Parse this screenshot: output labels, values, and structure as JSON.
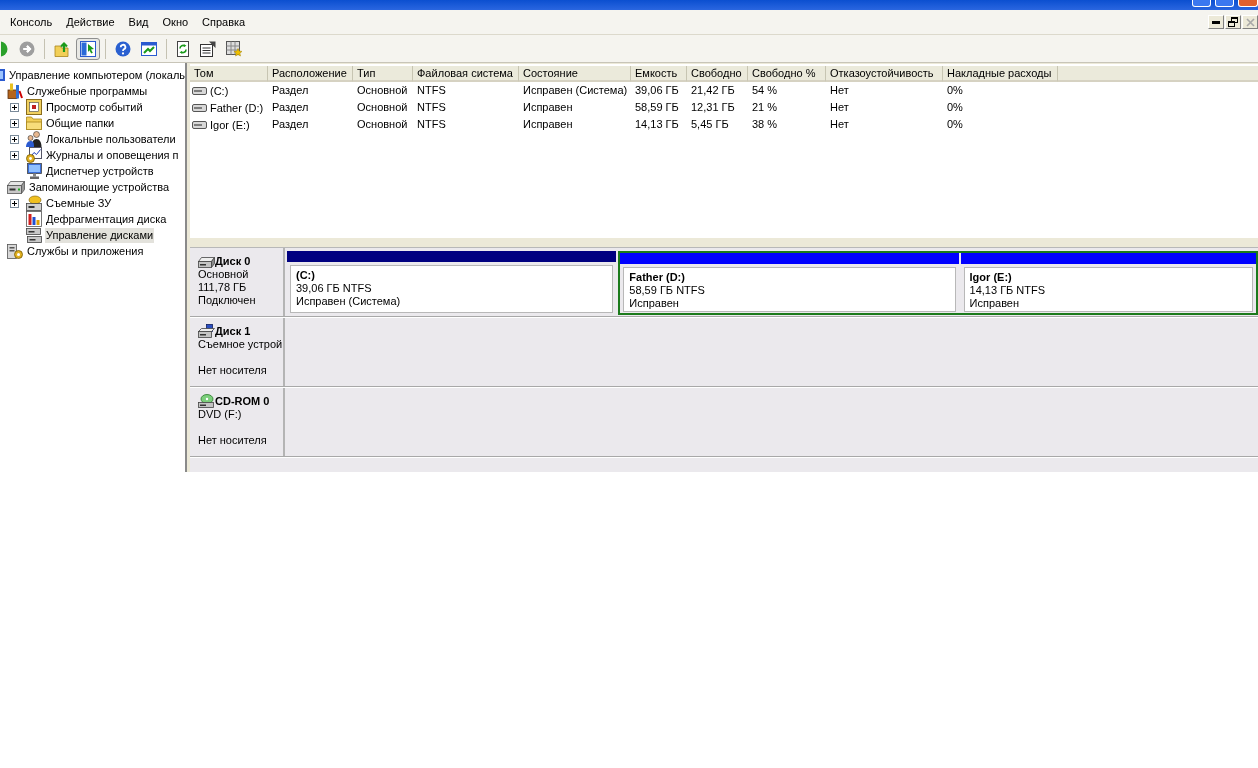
{
  "menu": [
    "Консоль",
    "Действие",
    "Вид",
    "Окно",
    "Справка"
  ],
  "window_controls": [
    {
      "disabled": false
    },
    {
      "disabled": false
    },
    {
      "disabled": true
    }
  ],
  "toolbar": [
    [
      {
        "pressed": false,
        "disabled": false
      },
      {
        "pressed": false,
        "disabled": true
      }
    ],
    [
      {
        "pressed": false,
        "disabled": false
      },
      {
        "pressed": true,
        "disabled": false
      }
    ],
    [
      {
        "pressed": false,
        "disabled": false
      },
      {
        "pressed": false,
        "disabled": false
      }
    ],
    [
      {
        "pressed": false,
        "disabled": false
      },
      {
        "pressed": false,
        "disabled": false
      },
      {
        "pressed": false,
        "disabled": false
      }
    ]
  ],
  "tree": [
    {
      "label": "Управление компьютером (локаль",
      "collapsed": false,
      "selected": false,
      "children": [
        {
          "label": "Служебные программы",
          "collapsed": false,
          "selected": false,
          "children": [
            {
              "label": "Просмотр событий",
              "collapsed": true,
              "selected": false
            },
            {
              "label": "Общие папки",
              "collapsed": true,
              "selected": false
            },
            {
              "label": "Локальные пользователи",
              "collapsed": true,
              "selected": false
            },
            {
              "label": "Журналы и оповещения п",
              "collapsed": true,
              "selected": false
            },
            {
              "label": "Диспетчер устройств",
              "collapsed": false,
              "selected": false
            }
          ]
        },
        {
          "label": "Запоминающие устройства",
          "collapsed": false,
          "selected": false,
          "children": [
            {
              "label": "Съемные ЗУ",
              "collapsed": true,
              "selected": false
            },
            {
              "label": "Дефрагментация диска",
              "collapsed": false,
              "selected": false
            },
            {
              "label": "Управление дисками",
              "collapsed": false,
              "selected": true
            }
          ]
        },
        {
          "label": "Службы и приложения",
          "collapsed": false,
          "selected": false
        }
      ]
    }
  ],
  "volume_list": {
    "columns": [
      "Том",
      "Расположение",
      "Тип",
      "Файловая система",
      "Состояние",
      "Емкость",
      "Свободно",
      "Свободно %",
      "Отказоустойчивость",
      "Накладные расходы"
    ],
    "rows": [
      {
        "selected": false,
        "cells": [
          "(C:)",
          "Раздел",
          "Основной",
          "NTFS",
          "Исправен (Система)",
          "39,06 ГБ",
          "21,42 ГБ",
          "54 %",
          "Нет",
          "0%"
        ]
      },
      {
        "selected": false,
        "cells": [
          "Father (D:)",
          "Раздел",
          "Основной",
          "NTFS",
          "Исправен",
          "58,59 ГБ",
          "12,31 ГБ",
          "21 %",
          "Нет",
          "0%"
        ]
      },
      {
        "selected": false,
        "cells": [
          "Igor (E:)",
          "Раздел",
          "Основной",
          "NTFS",
          "Исправен",
          "14,13 ГБ",
          "5,45 ГБ",
          "38 %",
          "Нет",
          "0%"
        ]
      }
    ]
  },
  "disks": [
    {
      "kind": "basic",
      "name": "Диск 0",
      "type": "Основной",
      "size": "111,78 ГБ",
      "status": "Подключен",
      "volumes": [
        {
          "kind": "primary",
          "name": "(C:)",
          "size": "39,06 ГБ NTFS",
          "status": "Исправен (Система)"
        },
        {
          "kind": "extended",
          "volumes": [
            {
              "kind": "logical",
              "name": "Father (D:)",
              "size": "58,59 ГБ NTFS",
              "status": "Исправен"
            },
            {
              "kind": "logical",
              "name": "Igor (E:)",
              "size": "14,13 ГБ NTFS",
              "status": "Исправен"
            }
          ]
        }
      ]
    },
    {
      "kind": "removable",
      "name": "Диск 1",
      "type": "Съемное устрой",
      "status": "Нет носителя"
    },
    {
      "kind": "cdrom",
      "name": "CD-ROM 0",
      "type": "DVD (F:)",
      "status": "Нет носителя"
    }
  ]
}
